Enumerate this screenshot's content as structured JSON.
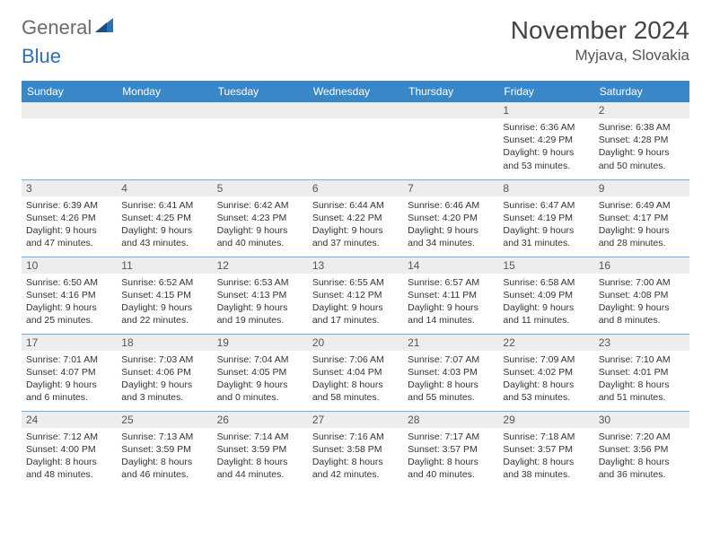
{
  "brand": {
    "word1": "General",
    "word2": "Blue"
  },
  "title": "November 2024",
  "location": "Myjava, Slovakia",
  "weekdays": [
    "Sunday",
    "Monday",
    "Tuesday",
    "Wednesday",
    "Thursday",
    "Friday",
    "Saturday"
  ],
  "weeks": [
    [
      null,
      null,
      null,
      null,
      null,
      {
        "n": "1",
        "sr": "Sunrise: 6:36 AM",
        "ss": "Sunset: 4:29 PM",
        "d1": "Daylight: 9 hours",
        "d2": "and 53 minutes."
      },
      {
        "n": "2",
        "sr": "Sunrise: 6:38 AM",
        "ss": "Sunset: 4:28 PM",
        "d1": "Daylight: 9 hours",
        "d2": "and 50 minutes."
      }
    ],
    [
      {
        "n": "3",
        "sr": "Sunrise: 6:39 AM",
        "ss": "Sunset: 4:26 PM",
        "d1": "Daylight: 9 hours",
        "d2": "and 47 minutes."
      },
      {
        "n": "4",
        "sr": "Sunrise: 6:41 AM",
        "ss": "Sunset: 4:25 PM",
        "d1": "Daylight: 9 hours",
        "d2": "and 43 minutes."
      },
      {
        "n": "5",
        "sr": "Sunrise: 6:42 AM",
        "ss": "Sunset: 4:23 PM",
        "d1": "Daylight: 9 hours",
        "d2": "and 40 minutes."
      },
      {
        "n": "6",
        "sr": "Sunrise: 6:44 AM",
        "ss": "Sunset: 4:22 PM",
        "d1": "Daylight: 9 hours",
        "d2": "and 37 minutes."
      },
      {
        "n": "7",
        "sr": "Sunrise: 6:46 AM",
        "ss": "Sunset: 4:20 PM",
        "d1": "Daylight: 9 hours",
        "d2": "and 34 minutes."
      },
      {
        "n": "8",
        "sr": "Sunrise: 6:47 AM",
        "ss": "Sunset: 4:19 PM",
        "d1": "Daylight: 9 hours",
        "d2": "and 31 minutes."
      },
      {
        "n": "9",
        "sr": "Sunrise: 6:49 AM",
        "ss": "Sunset: 4:17 PM",
        "d1": "Daylight: 9 hours",
        "d2": "and 28 minutes."
      }
    ],
    [
      {
        "n": "10",
        "sr": "Sunrise: 6:50 AM",
        "ss": "Sunset: 4:16 PM",
        "d1": "Daylight: 9 hours",
        "d2": "and 25 minutes."
      },
      {
        "n": "11",
        "sr": "Sunrise: 6:52 AM",
        "ss": "Sunset: 4:15 PM",
        "d1": "Daylight: 9 hours",
        "d2": "and 22 minutes."
      },
      {
        "n": "12",
        "sr": "Sunrise: 6:53 AM",
        "ss": "Sunset: 4:13 PM",
        "d1": "Daylight: 9 hours",
        "d2": "and 19 minutes."
      },
      {
        "n": "13",
        "sr": "Sunrise: 6:55 AM",
        "ss": "Sunset: 4:12 PM",
        "d1": "Daylight: 9 hours",
        "d2": "and 17 minutes."
      },
      {
        "n": "14",
        "sr": "Sunrise: 6:57 AM",
        "ss": "Sunset: 4:11 PM",
        "d1": "Daylight: 9 hours",
        "d2": "and 14 minutes."
      },
      {
        "n": "15",
        "sr": "Sunrise: 6:58 AM",
        "ss": "Sunset: 4:09 PM",
        "d1": "Daylight: 9 hours",
        "d2": "and 11 minutes."
      },
      {
        "n": "16",
        "sr": "Sunrise: 7:00 AM",
        "ss": "Sunset: 4:08 PM",
        "d1": "Daylight: 9 hours",
        "d2": "and 8 minutes."
      }
    ],
    [
      {
        "n": "17",
        "sr": "Sunrise: 7:01 AM",
        "ss": "Sunset: 4:07 PM",
        "d1": "Daylight: 9 hours",
        "d2": "and 6 minutes."
      },
      {
        "n": "18",
        "sr": "Sunrise: 7:03 AM",
        "ss": "Sunset: 4:06 PM",
        "d1": "Daylight: 9 hours",
        "d2": "and 3 minutes."
      },
      {
        "n": "19",
        "sr": "Sunrise: 7:04 AM",
        "ss": "Sunset: 4:05 PM",
        "d1": "Daylight: 9 hours",
        "d2": "and 0 minutes."
      },
      {
        "n": "20",
        "sr": "Sunrise: 7:06 AM",
        "ss": "Sunset: 4:04 PM",
        "d1": "Daylight: 8 hours",
        "d2": "and 58 minutes."
      },
      {
        "n": "21",
        "sr": "Sunrise: 7:07 AM",
        "ss": "Sunset: 4:03 PM",
        "d1": "Daylight: 8 hours",
        "d2": "and 55 minutes."
      },
      {
        "n": "22",
        "sr": "Sunrise: 7:09 AM",
        "ss": "Sunset: 4:02 PM",
        "d1": "Daylight: 8 hours",
        "d2": "and 53 minutes."
      },
      {
        "n": "23",
        "sr": "Sunrise: 7:10 AM",
        "ss": "Sunset: 4:01 PM",
        "d1": "Daylight: 8 hours",
        "d2": "and 51 minutes."
      }
    ],
    [
      {
        "n": "24",
        "sr": "Sunrise: 7:12 AM",
        "ss": "Sunset: 4:00 PM",
        "d1": "Daylight: 8 hours",
        "d2": "and 48 minutes."
      },
      {
        "n": "25",
        "sr": "Sunrise: 7:13 AM",
        "ss": "Sunset: 3:59 PM",
        "d1": "Daylight: 8 hours",
        "d2": "and 46 minutes."
      },
      {
        "n": "26",
        "sr": "Sunrise: 7:14 AM",
        "ss": "Sunset: 3:59 PM",
        "d1": "Daylight: 8 hours",
        "d2": "and 44 minutes."
      },
      {
        "n": "27",
        "sr": "Sunrise: 7:16 AM",
        "ss": "Sunset: 3:58 PM",
        "d1": "Daylight: 8 hours",
        "d2": "and 42 minutes."
      },
      {
        "n": "28",
        "sr": "Sunrise: 7:17 AM",
        "ss": "Sunset: 3:57 PM",
        "d1": "Daylight: 8 hours",
        "d2": "and 40 minutes."
      },
      {
        "n": "29",
        "sr": "Sunrise: 7:18 AM",
        "ss": "Sunset: 3:57 PM",
        "d1": "Daylight: 8 hours",
        "d2": "and 38 minutes."
      },
      {
        "n": "30",
        "sr": "Sunrise: 7:20 AM",
        "ss": "Sunset: 3:56 PM",
        "d1": "Daylight: 8 hours",
        "d2": "and 36 minutes."
      }
    ]
  ]
}
